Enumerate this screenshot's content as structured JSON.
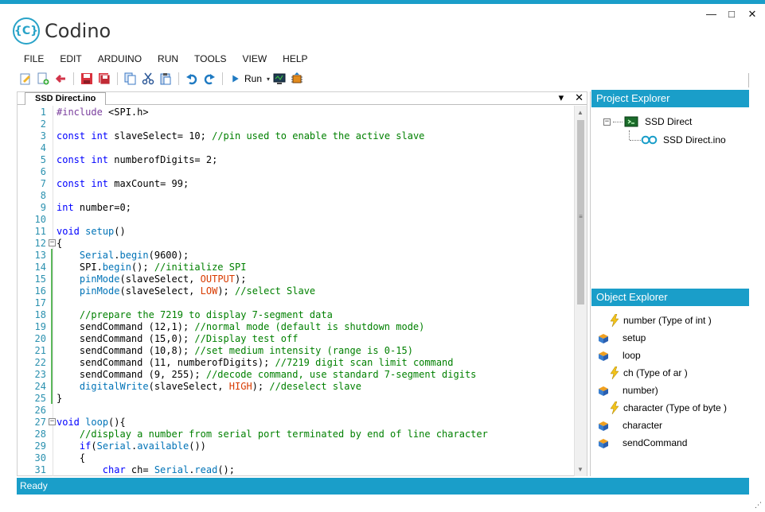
{
  "app": {
    "title": "Codino",
    "logo_glyph": "{C}"
  },
  "window_controls": {
    "minimize": "—",
    "maximize": "□",
    "close": "✕"
  },
  "menu": [
    "FILE",
    "EDIT",
    "ARDUINO",
    "RUN",
    "TOOLS",
    "VIEW",
    "HELP"
  ],
  "toolbar": {
    "run_label": "Run",
    "run_dropdown": "▾"
  },
  "editor": {
    "tab_label": "SSD Direct.ino",
    "tab_dropdown": "▾",
    "tab_close": "✕",
    "lines": [
      {
        "n": "1",
        "t": "#include <SPI.h>"
      },
      {
        "n": "2",
        "t": ""
      },
      {
        "n": "3",
        "t": "const int slaveSelect= 10; //pin used to enable the active slave"
      },
      {
        "n": "4",
        "t": ""
      },
      {
        "n": "5",
        "t": "const int numberofDigits= 2;"
      },
      {
        "n": "6",
        "t": ""
      },
      {
        "n": "7",
        "t": "const int maxCount= 99;"
      },
      {
        "n": "8",
        "t": ""
      },
      {
        "n": "9",
        "t": "int number=0;"
      },
      {
        "n": "10",
        "t": ""
      },
      {
        "n": "11",
        "t": "void setup()"
      },
      {
        "n": "12",
        "t": "{"
      },
      {
        "n": "13",
        "t": "    Serial.begin(9600);"
      },
      {
        "n": "14",
        "t": "    SPI.begin(); //initialize SPI"
      },
      {
        "n": "15",
        "t": "    pinMode(slaveSelect, OUTPUT);"
      },
      {
        "n": "16",
        "t": "    pinMode(slaveSelect, LOW); //select Slave"
      },
      {
        "n": "17",
        "t": ""
      },
      {
        "n": "18",
        "t": "    //prepare the 7219 to display 7-segment data"
      },
      {
        "n": "19",
        "t": "    sendCommand (12,1); //normal mode (default is shutdown mode)"
      },
      {
        "n": "20",
        "t": "    sendCommand (15,0); //Display test off"
      },
      {
        "n": "21",
        "t": "    sendCommand (10,8); //set medium intensity (range is 0-15)"
      },
      {
        "n": "22",
        "t": "    sendCommand (11, numberofDigits); //7219 digit scan limit command"
      },
      {
        "n": "23",
        "t": "    sendCommand (9, 255); //decode command, use standard 7-segment digits"
      },
      {
        "n": "24",
        "t": "    digitalWrite(slaveSelect, HIGH); //deselect slave"
      },
      {
        "n": "25",
        "t": "}"
      },
      {
        "n": "26",
        "t": ""
      },
      {
        "n": "27",
        "t": "void loop(){"
      },
      {
        "n": "28",
        "t": "    //display a number from serial port terminated by end of line character"
      },
      {
        "n": "29",
        "t": "    if(Serial.available())"
      },
      {
        "n": "30",
        "t": "    {"
      },
      {
        "n": "31",
        "t": "        char ch= Serial.read();"
      }
    ]
  },
  "project_explorer": {
    "title": "Project Explorer",
    "collapse_glyph": "−",
    "project": "SSD Direct",
    "file": "SSD Direct.ino"
  },
  "object_explorer": {
    "title": "Object Explorer",
    "items": [
      {
        "label": "number (Type of int )",
        "icon": "lightning-icon",
        "indent": 1
      },
      {
        "label": "setup",
        "icon": "method-icon",
        "indent": 0
      },
      {
        "label": "loop",
        "icon": "method-icon",
        "indent": 0
      },
      {
        "label": "ch (Type of ar )",
        "icon": "lightning-icon",
        "indent": 1
      },
      {
        "label": "number)",
        "icon": "method-icon",
        "indent": 0
      },
      {
        "label": "character (Type of byte )",
        "icon": "lightning-icon",
        "indent": 1
      },
      {
        "label": "character",
        "icon": "method-icon",
        "indent": 0
      },
      {
        "label": "sendCommand",
        "icon": "method-icon",
        "indent": 0
      }
    ]
  },
  "status": {
    "text": "Ready"
  },
  "colors": {
    "accent": "#1a9ec9",
    "keyword": "#0000ff",
    "comment": "#008000",
    "function": "#0073b7",
    "constant": "#d83b01"
  }
}
